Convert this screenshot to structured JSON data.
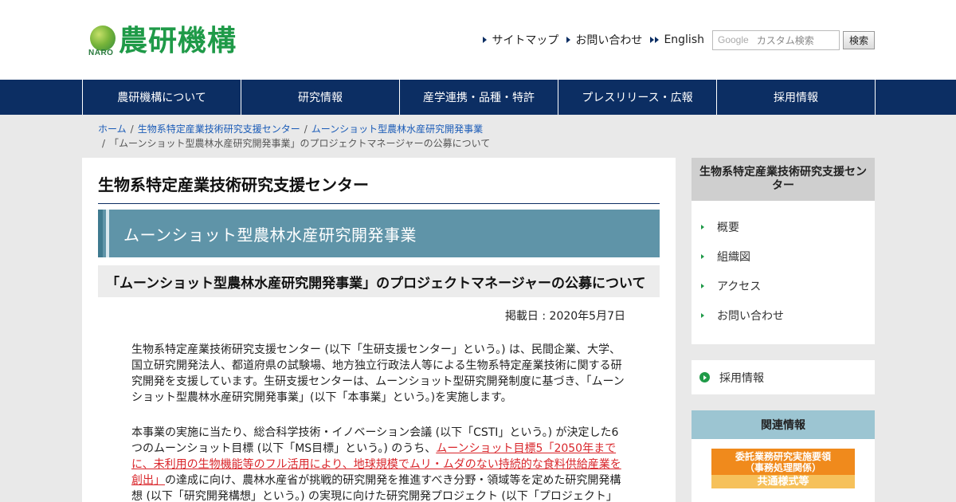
{
  "header": {
    "logo_mark_text": "NARO",
    "logo_text": "農研機構",
    "links": [
      "サイトマップ",
      "お問い合わせ",
      "English"
    ],
    "search_placeholder_brand": "Google",
    "search_placeholder": "カスタム検索",
    "search_button": "検索"
  },
  "nav": {
    "items": [
      "農研機構について",
      "研究情報",
      "産学連携・品種・特許",
      "プレスリリース・広報",
      "採用情報"
    ]
  },
  "breadcrumb": {
    "items": [
      "ホーム",
      "生物系特定産業技術研究支援センター",
      "ムーンショット型農林水産研究開発事業"
    ],
    "current": "「ムーンショット型農林水産研究開発事業」のプロジェクトマネージャーの公募について"
  },
  "main": {
    "center_title": "生物系特定産業技術研究支援センター",
    "banner_text": "ムーンショット型農林水産研究開発事業",
    "page_heading": "「ムーンショット型農林水産研究開発事業」のプロジェクトマネージャーの公募について",
    "post_date": "掲載日 : 2020年5月7日",
    "para1": "生物系特定産業技術研究支援センター (以下「生研支援センター」という。) は、民間企業、大学、国立研究開発法人、都道府県の試験場、地方独立行政法人等による生物系特定産業技術に関する研究開発を支援しています。生研支援センターは、ムーンショット型研究開発制度に基づき、「ムーンショット型農林水産研究開発事業」(以下「本事業」という。)を実施します。",
    "para2_a": "本事業の実施に当たり、総合科学技術・イノベーション会議 (以下「CSTI」という。) が決定した6つのムーンショット目標 (以下「MS目標」という。) のうち、",
    "para2_link": "ムーンショット目標5「2050年までに、未利用の生物機能等のフル活用により、地球規模でムリ・ムダのない持続的な食料供給産業を創出」",
    "para2_b": "の達成に向け、農林水産省が挑戦的研究開発を推進すべき分野・領域等を定めた研究開発構想 (以下「研究開発構想」という。) の実現に向けた研究開発プロジェクト (以下「プロジェクト」"
  },
  "sidebar": {
    "title": "生物系特定産業技術研究支援センター",
    "items": [
      "概要",
      "組織図",
      "アクセス",
      "お問い合わせ"
    ],
    "recruit": "採用情報",
    "related_title": "関連情報",
    "related_banner_l1": "委託業務研究実施要領",
    "related_banner_l2": "（事務処理関係）",
    "related_banner_l3": "共通様式等"
  },
  "colors": {
    "nav_bg": "#0c2e63",
    "brand_green": "#1f9a48",
    "banner_bg": "#5f94a8",
    "link_red": "#d9262b",
    "related_head": "#9cc5d2",
    "related_banner": "#f08a1c"
  }
}
